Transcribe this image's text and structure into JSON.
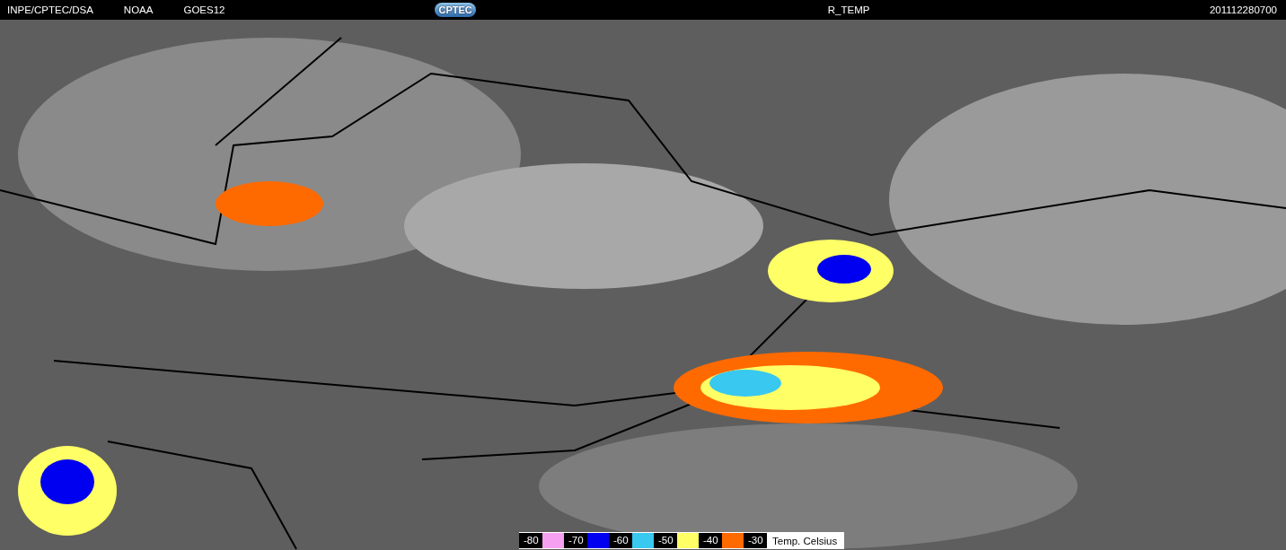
{
  "header": {
    "left": [
      "INPE/CPTEC/DSA",
      "NOAA",
      "GOES12"
    ],
    "logo": "CPTEC",
    "product": "R_TEMP",
    "timestamp": "201112280700"
  },
  "legend": {
    "entries": [
      {
        "label": "-80",
        "color": "#f5a0f0"
      },
      {
        "label": "-70",
        "color": "#0000f0"
      },
      {
        "label": "-60",
        "color": "#38c8f0"
      },
      {
        "label": "-50",
        "color": "#ffff66"
      },
      {
        "label": "-40",
        "color": "#ff6a00"
      }
    ],
    "last_label": "-30",
    "caption": "Temp. Celsius"
  }
}
